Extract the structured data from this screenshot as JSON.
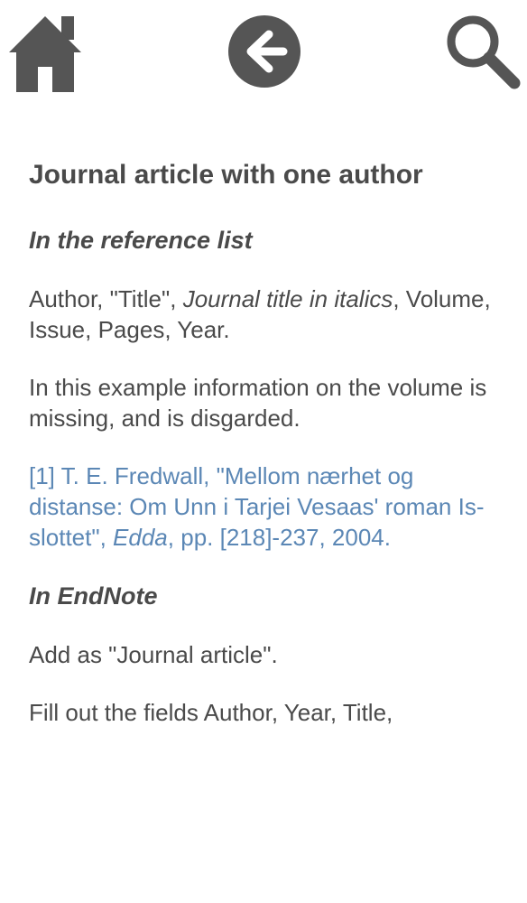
{
  "toolbar": {
    "home_icon": "house-icon",
    "back_icon": "back-arrow-icon",
    "search_icon": "magnifier-icon",
    "icon_color": "#555555"
  },
  "article": {
    "title": "Journal article with one author",
    "section_reference_list": "In the reference list",
    "format_part1": "Author, \"Title\", ",
    "format_italic": "Journal title in italics",
    "format_part2": ", Volume, Issue, Pages, Year.",
    "missing_info_note": "In this example information on the volume is missing, and is disgarded.",
    "example_part1": "[1] T. E. Fredwall, \"Mellom nærhet og distanse: Om Unn i Tarjei Vesaas' roman Is-slottet\", ",
    "example_italic": "Edda",
    "example_part2": ", pp. [218]-237, 2004.",
    "section_endnote": "In EndNote",
    "endnote_add": "Add as \"Journal article\".",
    "endnote_fill": "Fill out the fields Author, Year, Title,"
  },
  "colors": {
    "text": "#4a4a4a",
    "example_link": "#5b87b5",
    "background": "#ffffff"
  }
}
